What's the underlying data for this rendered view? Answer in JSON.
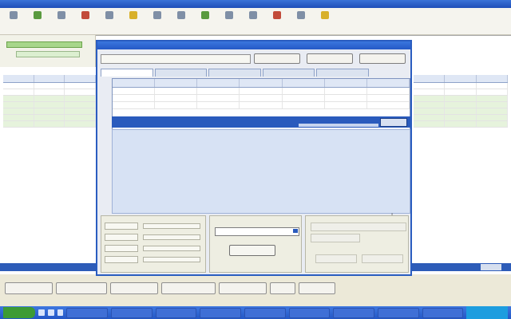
{
  "toolbar": {
    "items": [
      "",
      "",
      "",
      "",
      "",
      "",
      "",
      "",
      "",
      "",
      "",
      "",
      "",
      ""
    ]
  },
  "left_grid": {
    "rows": [
      [
        "",
        "",
        ""
      ],
      [
        "",
        "",
        ""
      ],
      [
        "",
        "",
        ""
      ],
      [
        "",
        "",
        ""
      ],
      [
        "",
        "",
        ""
      ],
      [
        "",
        "",
        ""
      ],
      [
        "",
        "",
        ""
      ]
    ]
  },
  "right_grid": {
    "rows": [
      [
        "",
        "",
        ""
      ],
      [
        "",
        "",
        ""
      ],
      [
        "",
        "",
        ""
      ],
      [
        "",
        "",
        ""
      ],
      [
        "",
        "",
        ""
      ],
      [
        "",
        "",
        ""
      ],
      [
        "",
        "",
        ""
      ]
    ]
  },
  "dialog": {
    "title": "",
    "tabs": [
      "",
      "",
      "",
      "",
      ""
    ],
    "buttons": [
      "",
      "",
      ""
    ],
    "inner_rows": [
      [
        "",
        "",
        "",
        "",
        "",
        "",
        ""
      ],
      [
        "",
        "",
        "",
        "",
        "",
        "",
        ""
      ],
      [
        "",
        "",
        "",
        "",
        "",
        "",
        ""
      ]
    ],
    "totals": {
      "title": "",
      "rows": [
        [
          "",
          ""
        ],
        [
          "",
          ""
        ],
        [
          "",
          ""
        ],
        [
          "",
          ""
        ]
      ]
    },
    "payment": {
      "title": "",
      "ok_label": ""
    }
  },
  "bottom_buttons": [
    "",
    "",
    "",
    "",
    "",
    "",
    ""
  ],
  "taskbar": {
    "start_label": "",
    "tasks": [
      "",
      "",
      "",
      "",
      "",
      "",
      "",
      "",
      ""
    ]
  },
  "colors": {
    "accent": "#2a5bbd",
    "title_bar": "#3a76de",
    "highlight_green": "#a7d68a"
  }
}
